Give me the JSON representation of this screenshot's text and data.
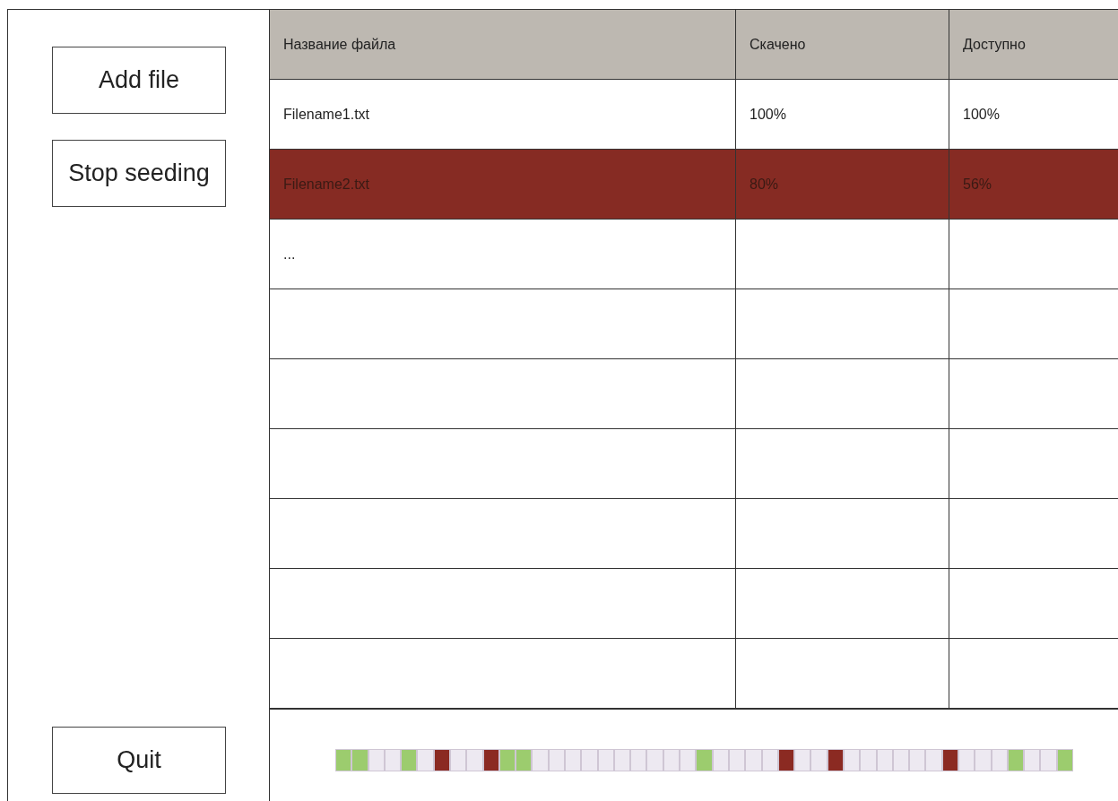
{
  "buttons": [
    {
      "label": "Add file",
      "kind": "top"
    },
    {
      "label": "Stop seeding",
      "kind": "top"
    },
    {
      "label": "Quit",
      "kind": "bottom"
    }
  ],
  "table": {
    "columns": [
      "Название файла",
      "Скачено",
      "Доступно"
    ],
    "rows": [
      {
        "cells": [
          "Filename1.txt",
          "100%",
          "100%"
        ],
        "selected": false
      },
      {
        "cells": [
          "Filename2.txt",
          "80%",
          "56%"
        ],
        "selected": true
      },
      {
        "cells": [
          "..."
        ],
        "selected": false
      }
    ]
  },
  "pieces": [
    {
      "color": "#9ccc6e"
    },
    {
      "color": "#9ccc6e"
    },
    {
      "color": "#ede9f1"
    },
    {
      "color": "#ede9f1"
    },
    {
      "color": "#9ccc6e"
    },
    {
      "color": "#ede9f1"
    },
    {
      "color": "#8b2a22"
    },
    {
      "color": "#ede9f1"
    },
    {
      "color": "#ede9f1"
    },
    {
      "color": "#8b2a22"
    },
    {
      "color": "#9ccc6e"
    },
    {
      "color": "#9ccc6e"
    },
    {
      "color": "#ede9f1"
    },
    {
      "color": "#ede9f1"
    },
    {
      "color": "#ede9f1"
    },
    {
      "color": "#ede9f1"
    },
    {
      "color": "#ede9f1"
    },
    {
      "color": "#ede9f1"
    },
    {
      "color": "#ede9f1"
    },
    {
      "color": "#ede9f1"
    },
    {
      "color": "#ede9f1"
    },
    {
      "color": "#ede9f1"
    },
    {
      "color": "#9ccc6e"
    },
    {
      "color": "#ede9f1"
    },
    {
      "color": "#ede9f1"
    },
    {
      "color": "#ede9f1"
    },
    {
      "color": "#ede9f1"
    },
    {
      "color": "#8b2a22"
    },
    {
      "color": "#ede9f1"
    },
    {
      "color": "#ede9f1"
    },
    {
      "color": "#8b2a22"
    },
    {
      "color": "#ede9f1"
    },
    {
      "color": "#ede9f1"
    },
    {
      "color": "#ede9f1"
    },
    {
      "color": "#ede9f1"
    },
    {
      "color": "#ede9f1"
    },
    {
      "color": "#ede9f1"
    },
    {
      "color": "#8b2a22"
    },
    {
      "color": "#ede9f1"
    },
    {
      "color": "#ede9f1"
    },
    {
      "color": "#ede9f1"
    },
    {
      "color": "#9ccc6e"
    },
    {
      "color": "#ede9f1"
    },
    {
      "color": "#ede9f1"
    },
    {
      "color": "#9ccc6e"
    }
  ]
}
